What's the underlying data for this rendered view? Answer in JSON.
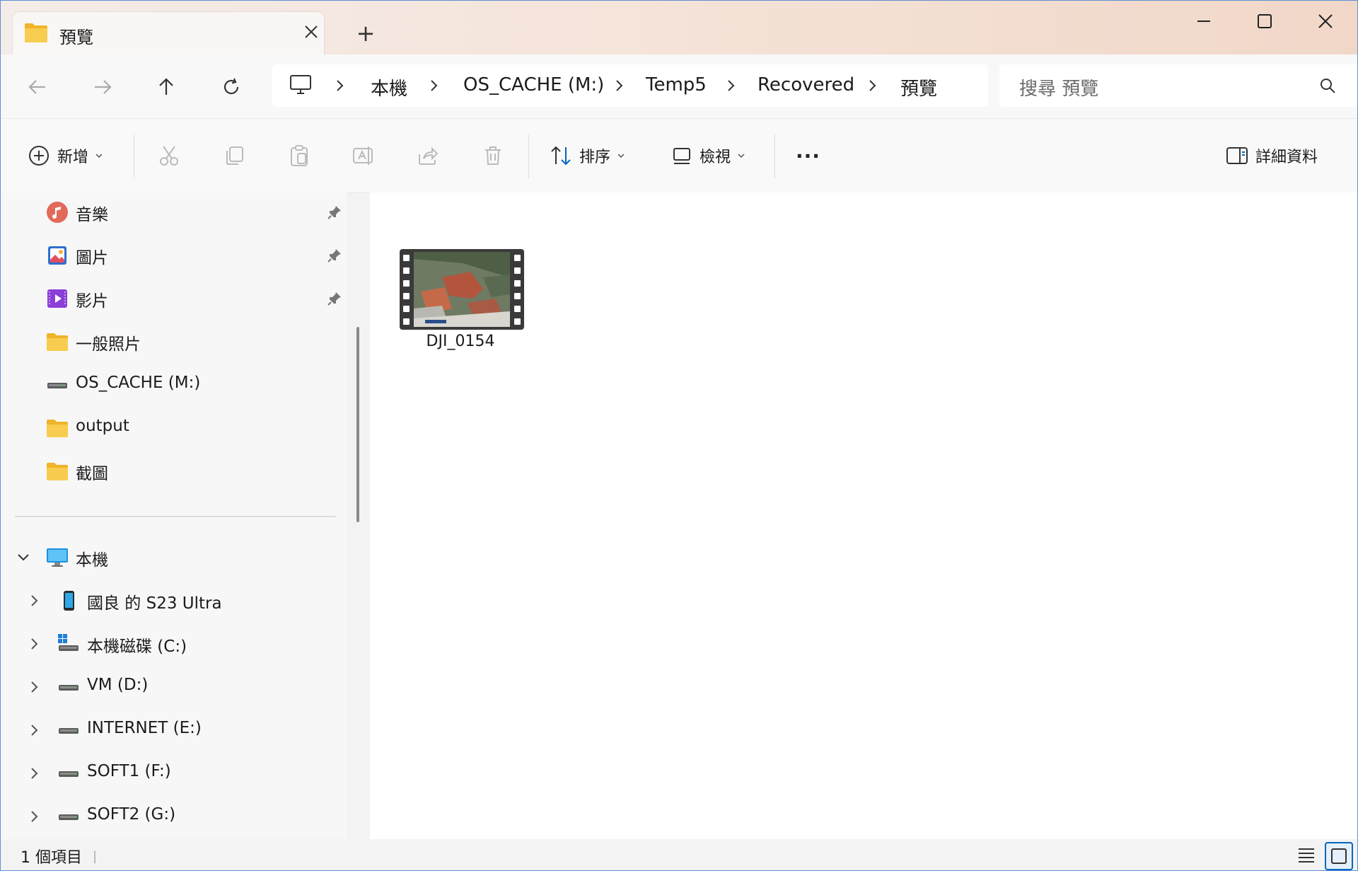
{
  "window": {
    "tab_title": "預覽",
    "new_tab_symbol": "+"
  },
  "nav": {
    "breadcrumbs": [
      "本機",
      "OS_CACHE (M:)",
      "Temp5",
      "Recovered",
      "預覽"
    ],
    "search_placeholder": "搜尋 預覽"
  },
  "toolbar": {
    "new_label": "新增",
    "sort_label": "排序",
    "view_label": "檢視",
    "more_label": "···",
    "details_label": "詳細資料"
  },
  "sidebar": {
    "quick_access": [
      {
        "label": "音樂",
        "icon": "music-icon",
        "pinned": true
      },
      {
        "label": "圖片",
        "icon": "pictures-icon",
        "pinned": true
      },
      {
        "label": "影片",
        "icon": "videos-icon",
        "pinned": true
      },
      {
        "label": "一般照片",
        "icon": "folder-icon",
        "pinned": false
      },
      {
        "label": "OS_CACHE (M:)",
        "icon": "drive-icon",
        "pinned": false
      },
      {
        "label": "output",
        "icon": "folder-icon",
        "pinned": false
      },
      {
        "label": "截圖",
        "icon": "folder-icon",
        "pinned": false
      }
    ],
    "this_pc": {
      "label": "本機",
      "icon": "computer-icon",
      "expanded": true
    },
    "devices": [
      {
        "label": "國良 的 S23 Ultra",
        "icon": "phone-icon"
      },
      {
        "label": "本機磁碟 (C:)",
        "icon": "windows-drive-icon"
      },
      {
        "label": "VM (D:)",
        "icon": "drive-icon"
      },
      {
        "label": "INTERNET (E:)",
        "icon": "drive-icon"
      },
      {
        "label": "SOFT1 (F:)",
        "icon": "drive-icon"
      },
      {
        "label": "SOFT2 (G:)",
        "icon": "drive-icon"
      }
    ]
  },
  "content": {
    "files": [
      {
        "name": "DJI_0154",
        "type": "video",
        "icon": "video-thumbnail-icon"
      }
    ]
  },
  "status": {
    "item_count": "1 個項目"
  },
  "colors": {
    "accent": "#0067c0",
    "folder": "#f6c343",
    "window_border": "#5b8fd6"
  }
}
